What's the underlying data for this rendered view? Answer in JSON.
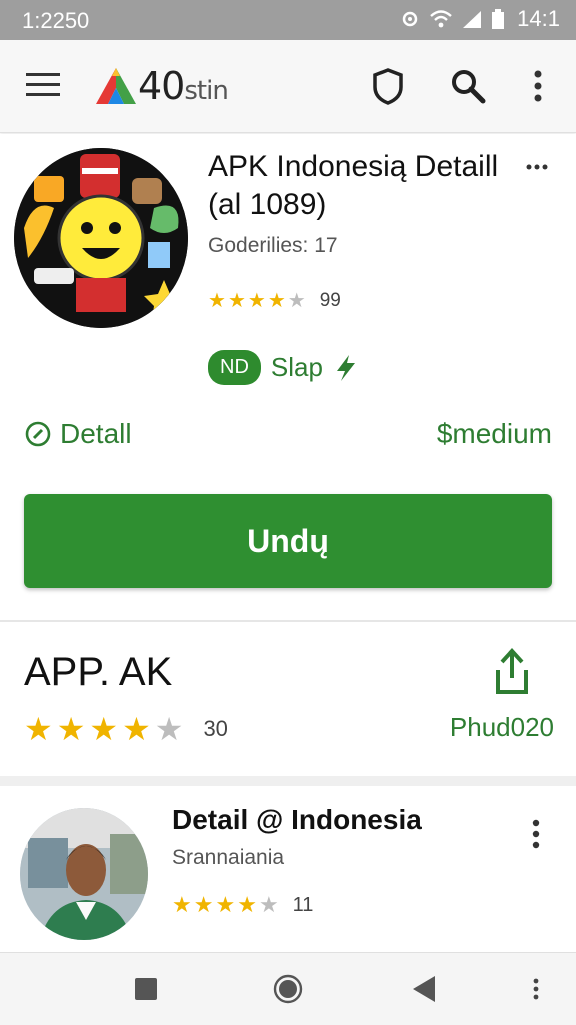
{
  "status_bar": {
    "time_left": "1:2250",
    "time_right": "14:1"
  },
  "app_bar": {
    "logo_text": "40",
    "logo_suffix": "stin",
    "icons": [
      "menu-icon",
      "shield-icon",
      "search-icon",
      "more-vert-icon"
    ]
  },
  "app": {
    "title": "APK Indonesią Detaill (al 1089)",
    "subtitle": "Goderilies: 17",
    "rating_count": "99",
    "rating_value": 4,
    "badge": "ND",
    "badge_label": "Slap",
    "detail_label": "Detall",
    "price_label": "$medium",
    "install_label": "Undų"
  },
  "section2": {
    "title": "APP. AK",
    "rating_count": "30",
    "rating_value": 4,
    "right_label": "Phud020"
  },
  "list_item": {
    "title": "Detail @ Indonesia",
    "subtitle": "Srannaiania",
    "rating_count": "11",
    "rating_value": 4
  },
  "colors": {
    "accent": "#2f8f31",
    "accent_text": "#2e7d32",
    "star": "#f0b400",
    "star_empty": "#bdbdbd",
    "status_bar": "#9e9e9e"
  },
  "nav_icons": [
    "recent-apps-icon",
    "home-icon",
    "back-icon",
    "more-vert-icon"
  ]
}
